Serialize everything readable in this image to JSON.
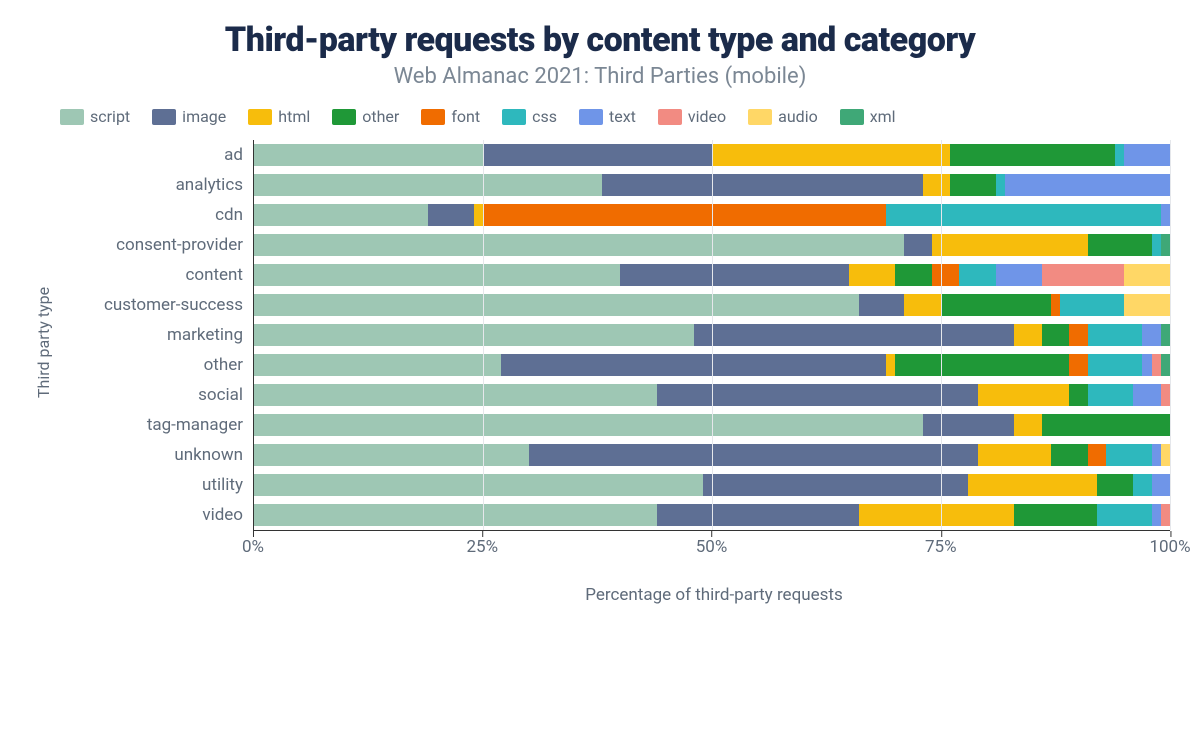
{
  "title": "Third-party requests by content type and category",
  "subtitle": "Web Almanac 2021: Third Parties (mobile)",
  "xlabel": "Percentage of third-party requests",
  "ylabel": "Third party type",
  "x_ticks": [
    "0%",
    "25%",
    "50%",
    "75%",
    "100%"
  ],
  "x_tick_positions": [
    0,
    25,
    50,
    75,
    100
  ],
  "legend": [
    {
      "key": "script",
      "label": "script",
      "color": "#9ec7b4"
    },
    {
      "key": "image",
      "label": "image",
      "color": "#5e6f94"
    },
    {
      "key": "html",
      "label": "html",
      "color": "#f7bd0c"
    },
    {
      "key": "other",
      "label": "other",
      "color": "#1f9837"
    },
    {
      "key": "font",
      "label": "font",
      "color": "#f06c00"
    },
    {
      "key": "css",
      "label": "css",
      "color": "#2eb8bd"
    },
    {
      "key": "text",
      "label": "text",
      "color": "#6f95e8"
    },
    {
      "key": "video",
      "label": "video",
      "color": "#f28b82"
    },
    {
      "key": "audio",
      "label": "audio",
      "color": "#ffd766"
    },
    {
      "key": "xml",
      "label": "xml",
      "color": "#3fa877"
    }
  ],
  "chart_data": {
    "type": "bar",
    "stacked": true,
    "orientation": "horizontal",
    "unit": "percent",
    "xlim": [
      0,
      100
    ],
    "categories": [
      "ad",
      "analytics",
      "cdn",
      "consent-provider",
      "content",
      "customer-success",
      "marketing",
      "other",
      "social",
      "tag-manager",
      "unknown",
      "utility",
      "video"
    ],
    "series_order": [
      "script",
      "image",
      "html",
      "other",
      "font",
      "css",
      "text",
      "video",
      "audio",
      "xml"
    ],
    "values": {
      "ad": {
        "script": 25,
        "image": 25,
        "html": 26,
        "other": 18,
        "font": 0,
        "css": 1,
        "text": 5,
        "video": 0,
        "audio": 0,
        "xml": 0
      },
      "analytics": {
        "script": 38,
        "image": 35,
        "html": 3,
        "other": 5,
        "font": 0,
        "css": 1,
        "text": 18,
        "video": 0,
        "audio": 0,
        "xml": 0
      },
      "cdn": {
        "script": 19,
        "image": 5,
        "html": 1,
        "other": 0,
        "font": 44,
        "css": 30,
        "text": 1,
        "video": 0,
        "audio": 0,
        "xml": 0
      },
      "consent-provider": {
        "script": 71,
        "image": 3,
        "html": 17,
        "other": 7,
        "font": 0,
        "css": 1,
        "text": 0,
        "video": 0,
        "audio": 0,
        "xml": 1
      },
      "content": {
        "script": 40,
        "image": 25,
        "html": 5,
        "other": 4,
        "font": 3,
        "css": 4,
        "text": 5,
        "video": 9,
        "audio": 5,
        "xml": 0
      },
      "customer-success": {
        "script": 66,
        "image": 5,
        "html": 4,
        "other": 12,
        "font": 1,
        "css": 7,
        "text": 0,
        "video": 0,
        "audio": 5,
        "xml": 0
      },
      "marketing": {
        "script": 48,
        "image": 35,
        "html": 3,
        "other": 3,
        "font": 2,
        "css": 6,
        "text": 2,
        "video": 0,
        "audio": 0,
        "xml": 1
      },
      "other": {
        "script": 27,
        "image": 42,
        "html": 1,
        "other": 19,
        "font": 2,
        "css": 6,
        "text": 1,
        "video": 1,
        "audio": 0,
        "xml": 1
      },
      "social": {
        "script": 44,
        "image": 35,
        "html": 10,
        "other": 2,
        "font": 0,
        "css": 5,
        "text": 3,
        "video": 1,
        "audio": 0,
        "xml": 0
      },
      "tag-manager": {
        "script": 73,
        "image": 10,
        "html": 3,
        "other": 14,
        "font": 0,
        "css": 0,
        "text": 0,
        "video": 0,
        "audio": 0,
        "xml": 0
      },
      "unknown": {
        "script": 30,
        "image": 49,
        "html": 8,
        "other": 4,
        "font": 2,
        "css": 5,
        "text": 1,
        "video": 0,
        "audio": 1,
        "xml": 0
      },
      "utility": {
        "script": 49,
        "image": 29,
        "html": 14,
        "other": 4,
        "font": 0,
        "css": 2,
        "text": 2,
        "video": 0,
        "audio": 0,
        "xml": 0
      },
      "video": {
        "script": 44,
        "image": 22,
        "html": 17,
        "other": 9,
        "font": 0,
        "css": 6,
        "text": 1,
        "video": 1,
        "audio": 0,
        "xml": 0
      }
    }
  }
}
